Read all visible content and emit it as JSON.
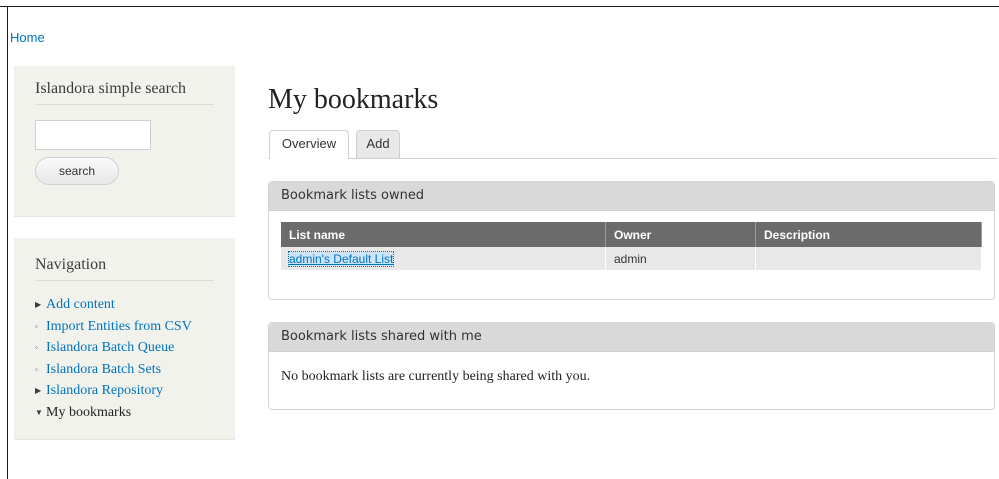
{
  "breadcrumb": {
    "home": "Home"
  },
  "search_block": {
    "title": "Islandora simple search",
    "input_value": "",
    "button_label": "search"
  },
  "navigation": {
    "title": "Navigation",
    "items": [
      {
        "label": "Add content",
        "bullet": "▶"
      },
      {
        "label": "Import Entities from CSV",
        "bullet": "◦"
      },
      {
        "label": "Islandora Batch Queue",
        "bullet": "◦"
      },
      {
        "label": "Islandora Batch Sets",
        "bullet": "◦"
      },
      {
        "label": "Islandora Repository",
        "bullet": "▶"
      },
      {
        "label": "My bookmarks",
        "bullet": "▼"
      }
    ]
  },
  "main": {
    "title": "My bookmarks",
    "tabs": [
      {
        "label": "Overview"
      },
      {
        "label": "Add"
      }
    ],
    "owned": {
      "header": "Bookmark lists owned",
      "columns": [
        "List name",
        "Owner",
        "Description"
      ],
      "rows": [
        {
          "name": "admin's Default List",
          "owner": "admin",
          "description": ""
        }
      ]
    },
    "shared": {
      "header": "Bookmark lists shared with me",
      "empty_text": "No bookmark lists are currently being shared with you."
    }
  }
}
